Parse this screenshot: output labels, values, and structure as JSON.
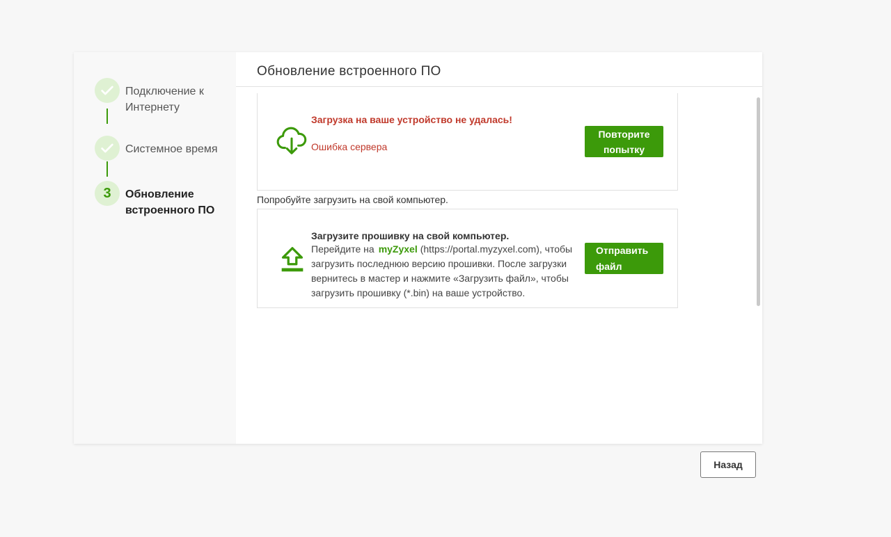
{
  "wizard": {
    "title": "Обновление встроенного ПО",
    "steps": [
      {
        "label": "Подключение к Интернету",
        "state": "done"
      },
      {
        "label": "Системное время",
        "state": "done"
      },
      {
        "number": "3",
        "label": "Обновление встроенного ПО",
        "state": "active"
      }
    ]
  },
  "error_card": {
    "icon": "cloud-download-icon",
    "title": "Загрузка на ваше устройство не удалась!",
    "subtitle": "Ошибка сервера",
    "retry_label": "Повторите попытку"
  },
  "hint": "Попробуйте загрузить на свой компьютер.",
  "upload_card": {
    "icon": "upload-icon",
    "title": "Загрузите прошивку на свой компьютер.",
    "body_prefix": "Перейдите на",
    "link_text": "myZyxel",
    "body_suffix": "(https://portal.myzyxel.com), чтобы загрузить последнюю версию прошивки. После загрузки вернитесь в мастер и нажмите «Загрузить файл», чтобы загрузить прошивку (*.bin) на ваше устройство.",
    "send_label": "Отправить файл"
  },
  "footer": {
    "back_label": "Назад"
  },
  "colors": {
    "accent": "#3c9a0a",
    "error": "#c0392b",
    "step_badge_bg": "#dff1d3"
  }
}
